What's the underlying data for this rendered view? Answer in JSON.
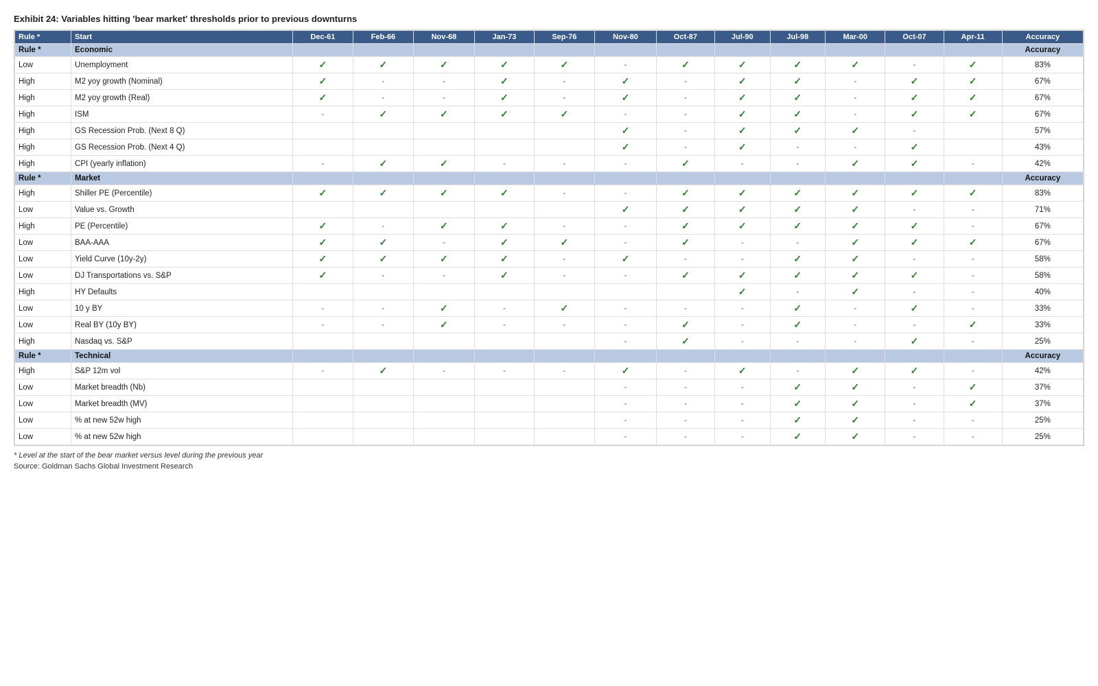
{
  "title": "Exhibit 24: Variables hitting 'bear market' thresholds prior to previous downturns",
  "headers": {
    "rule": "Rule *",
    "start": "Start",
    "periods": [
      "Dec-61",
      "Feb-66",
      "Nov-68",
      "Jan-73",
      "Sep-76",
      "Nov-80",
      "Oct-87",
      "Jul-90",
      "Jul-98",
      "Mar-00",
      "Oct-07",
      "Apr-11"
    ],
    "accuracy": "Accuracy"
  },
  "sections": [
    {
      "section_rule": "Rule *",
      "section_name": "Economic",
      "rows": [
        {
          "rule": "Low",
          "name": "Unemployment",
          "vals": [
            "✓",
            "✓",
            "✓",
            "✓",
            "✓",
            "-",
            "✓",
            "✓",
            "✓",
            "✓",
            "-",
            "✓"
          ],
          "accuracy": "83%"
        },
        {
          "rule": "High",
          "name": "M2 yoy growth (Nominal)",
          "vals": [
            "✓",
            "-",
            "-",
            "✓",
            "-",
            "✓",
            "-",
            "✓",
            "✓",
            "-",
            "✓",
            "✓"
          ],
          "accuracy": "67%"
        },
        {
          "rule": "High",
          "name": "M2 yoy growth (Real)",
          "vals": [
            "✓",
            "-",
            "-",
            "✓",
            "-",
            "✓",
            "-",
            "✓",
            "✓",
            "-",
            "✓",
            "✓"
          ],
          "accuracy": "67%"
        },
        {
          "rule": "High",
          "name": "ISM",
          "vals": [
            "-",
            "✓",
            "✓",
            "✓",
            "✓",
            "-",
            "-",
            "✓",
            "✓",
            "-",
            "✓",
            "✓"
          ],
          "accuracy": "67%"
        },
        {
          "rule": "High",
          "name": "GS Recession Prob. (Next 8 Q)",
          "vals": [
            "",
            "",
            "",
            "",
            "",
            "✓",
            "-",
            "✓",
            "✓",
            "✓",
            "-",
            ""
          ],
          "accuracy": "57%"
        },
        {
          "rule": "High",
          "name": "GS Recession Prob. (Next 4 Q)",
          "vals": [
            "",
            "",
            "",
            "",
            "",
            "✓",
            "-",
            "✓",
            "-",
            "-",
            "✓",
            ""
          ],
          "accuracy": "43%"
        },
        {
          "rule": "High",
          "name": "CPI (yearly inflation)",
          "vals": [
            "-",
            "✓",
            "✓",
            "-",
            "-",
            "-",
            "✓",
            "-",
            "-",
            "✓",
            "✓",
            "-"
          ],
          "accuracy": "42%"
        }
      ]
    },
    {
      "section_rule": "Rule *",
      "section_name": "Market",
      "rows": [
        {
          "rule": "High",
          "name": "Shiller PE (Percentile)",
          "vals": [
            "✓",
            "✓",
            "✓",
            "✓",
            "-",
            "-",
            "✓",
            "✓",
            "✓",
            "✓",
            "✓",
            "✓"
          ],
          "accuracy": "83%"
        },
        {
          "rule": "Low",
          "name": "Value vs. Growth",
          "vals": [
            "",
            "",
            "",
            "",
            "",
            "✓",
            "✓",
            "✓",
            "✓",
            "✓",
            "-",
            "-"
          ],
          "accuracy": "71%"
        },
        {
          "rule": "High",
          "name": "PE (Percentile)",
          "vals": [
            "✓",
            "-",
            "✓",
            "✓",
            "-",
            "-",
            "✓",
            "✓",
            "✓",
            "✓",
            "✓",
            "-"
          ],
          "accuracy": "67%"
        },
        {
          "rule": "Low",
          "name": "BAA-AAA",
          "vals": [
            "✓",
            "✓",
            "-",
            "✓",
            "✓",
            "-",
            "✓",
            "-",
            "-",
            "✓",
            "✓",
            "✓"
          ],
          "accuracy": "67%"
        },
        {
          "rule": "Low",
          "name": "Yield Curve (10y-2y)",
          "vals": [
            "✓",
            "✓",
            "✓",
            "✓",
            "-",
            "✓",
            "-",
            "-",
            "✓",
            "✓",
            "-",
            "-"
          ],
          "accuracy": "58%"
        },
        {
          "rule": "Low",
          "name": "DJ Transportations vs. S&P",
          "vals": [
            "✓",
            "-",
            "-",
            "✓",
            "-",
            "-",
            "✓",
            "✓",
            "✓",
            "✓",
            "✓",
            "-"
          ],
          "accuracy": "58%"
        },
        {
          "rule": "High",
          "name": "HY Defaults",
          "vals": [
            "",
            "",
            "",
            "",
            "",
            "",
            "",
            "✓",
            "-",
            "✓",
            "-",
            "-"
          ],
          "accuracy": "40%"
        },
        {
          "rule": "Low",
          "name": "10 y BY",
          "vals": [
            "-",
            "-",
            "✓",
            "-",
            "✓",
            "-",
            "-",
            "-",
            "✓",
            "-",
            "✓",
            "-"
          ],
          "accuracy": "33%"
        },
        {
          "rule": "Low",
          "name": "Real BY (10y BY)",
          "vals": [
            "-",
            "-",
            "✓",
            "-",
            "-",
            "-",
            "✓",
            "-",
            "✓",
            "-",
            "-",
            "✓"
          ],
          "accuracy": "33%"
        },
        {
          "rule": "High",
          "name": "Nasdaq vs. S&P",
          "vals": [
            "",
            "",
            "",
            "",
            "",
            "-",
            "✓",
            "-",
            "-",
            "-",
            "✓",
            "-"
          ],
          "accuracy": "25%"
        }
      ]
    },
    {
      "section_rule": "Rule *",
      "section_name": "Technical",
      "rows": [
        {
          "rule": "High",
          "name": "S&P 12m vol",
          "vals": [
            "-",
            "✓",
            "-",
            "-",
            "-",
            "✓",
            "-",
            "✓",
            "-",
            "✓",
            "✓",
            "-"
          ],
          "accuracy": "42%"
        },
        {
          "rule": "Low",
          "name": "Market breadth (Nb)",
          "vals": [
            "",
            "",
            "",
            "",
            "",
            "-",
            "-",
            "-",
            "✓",
            "✓",
            "-",
            "✓"
          ],
          "accuracy": "37%"
        },
        {
          "rule": "Low",
          "name": "Market breadth (MV)",
          "vals": [
            "",
            "",
            "",
            "",
            "",
            "-",
            "-",
            "-",
            "✓",
            "✓",
            "-",
            "✓"
          ],
          "accuracy": "37%"
        },
        {
          "rule": "Low",
          "name": "% at new 52w high",
          "vals": [
            "",
            "",
            "",
            "",
            "",
            "-",
            "-",
            "-",
            "✓",
            "✓",
            "-",
            "-"
          ],
          "accuracy": "25%"
        },
        {
          "rule": "Low",
          "name": "% at new 52w high",
          "vals": [
            "",
            "",
            "",
            "",
            "",
            "-",
            "-",
            "-",
            "✓",
            "✓",
            "-",
            "-"
          ],
          "accuracy": "25%"
        }
      ]
    }
  ],
  "footnote": "* Level at the start of the bear market versus level during the previous year",
  "source": "Source: Goldman Sachs Global Investment Research"
}
